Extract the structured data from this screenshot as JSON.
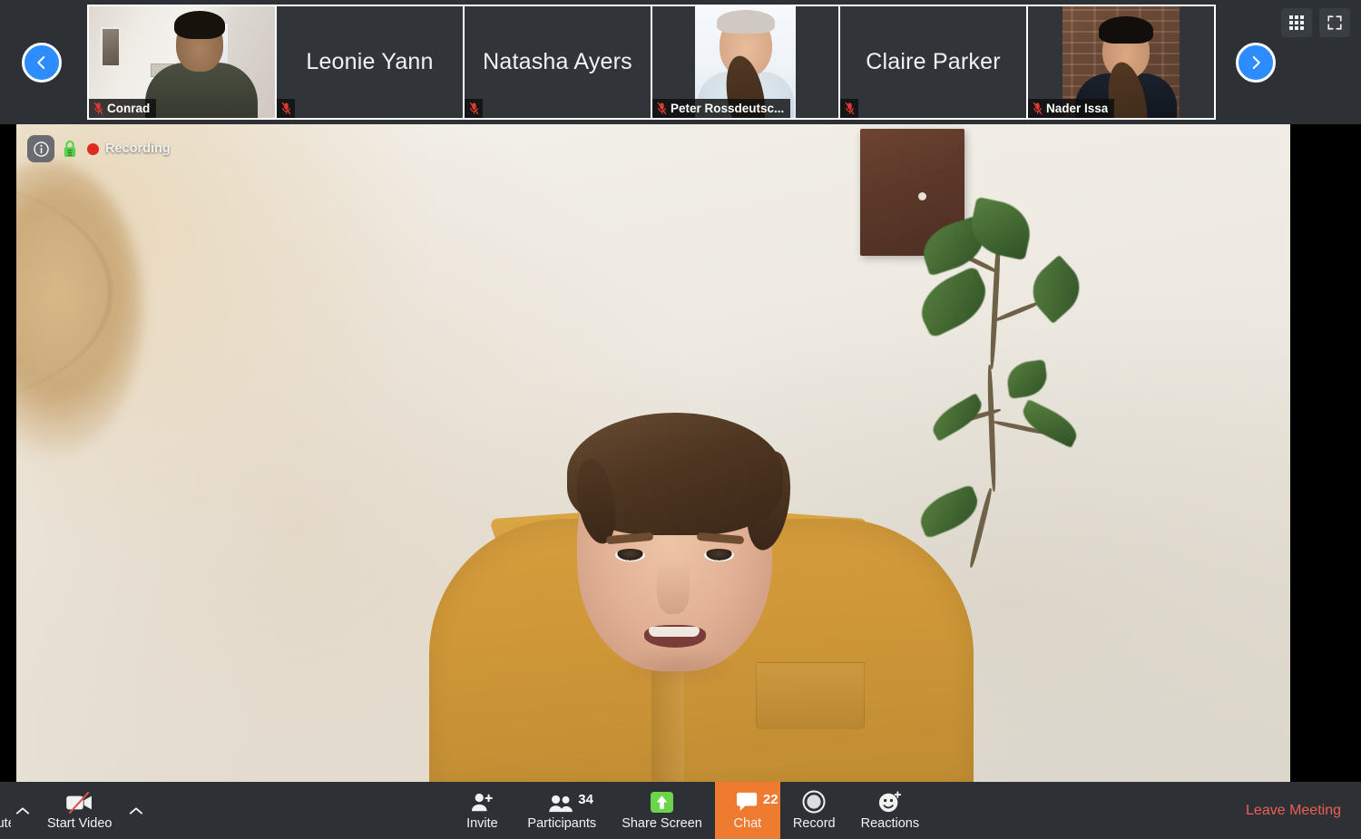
{
  "filmstrip": {
    "prev_button": "previous-participants",
    "next_button": "next-participants",
    "tiles": [
      {
        "name": "Conrad",
        "muted": true,
        "has_video": true,
        "style": "conrad"
      },
      {
        "name": "Leonie Yann",
        "muted": true,
        "has_video": false,
        "style": "none"
      },
      {
        "name": "Natasha Ayers",
        "muted": true,
        "has_video": false,
        "style": "none"
      },
      {
        "name": "Peter Rossdeutsc...",
        "muted": true,
        "has_video": true,
        "style": "peter"
      },
      {
        "name": "Claire Parker",
        "muted": true,
        "has_video": false,
        "style": "none"
      },
      {
        "name": "Nader Issa",
        "muted": true,
        "has_video": true,
        "style": "nader"
      }
    ],
    "view_icons": [
      {
        "name": "gallery-view-icon",
        "label": "Gallery View"
      },
      {
        "name": "fullscreen-icon",
        "label": "Enter Full Screen"
      }
    ]
  },
  "stage": {
    "info_icon": "meeting-info-icon",
    "encryption_icon": "encryption-lock-icon",
    "recording_label": "Recording",
    "recording_color": "#e02b20"
  },
  "toolbar": {
    "audio": {
      "label": "e",
      "full_label": "Unmute",
      "truncated": true
    },
    "video": {
      "label": "Start Video",
      "icon": "video-off-icon"
    },
    "invite": {
      "label": "Invite",
      "icon": "add-person-icon"
    },
    "participants": {
      "label": "Participants",
      "icon": "people-icon",
      "count": "34"
    },
    "share_screen": {
      "label": "Share Screen",
      "icon": "share-up-arrow-icon",
      "icon_color": "#6cd44a"
    },
    "chat": {
      "label": "Chat",
      "icon": "chat-bubble-icon",
      "count": "22",
      "active": true,
      "active_color": "#ee7b30"
    },
    "record": {
      "label": "Record",
      "icon": "record-circle-icon"
    },
    "reactions": {
      "label": "Reactions",
      "icon": "smiley-plus-icon"
    },
    "leave": {
      "label": "Leave Meeting",
      "color": "#ef5e52"
    }
  }
}
